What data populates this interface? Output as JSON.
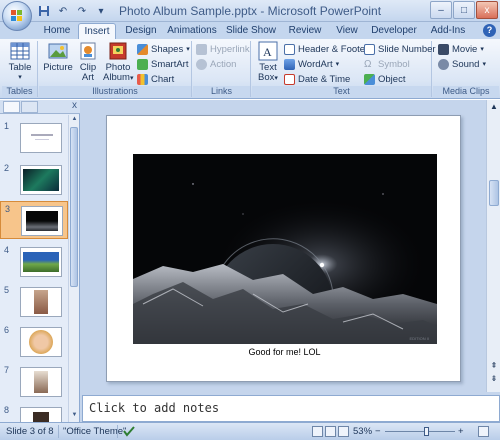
{
  "window": {
    "title": "Photo Album Sample.pptx - Microsoft PowerPoint",
    "minimize_glyph": "–",
    "maximize_glyph": "□",
    "close_glyph": "x"
  },
  "quick_access": {
    "undo_glyph": "↶",
    "redo_glyph": "↷",
    "customize_glyph": "▾"
  },
  "tabs": [
    "Home",
    "Insert",
    "Design",
    "Animations",
    "Slide Show",
    "Review",
    "View",
    "Developer",
    "Add-Ins"
  ],
  "active_tab": "Insert",
  "help_glyph": "?",
  "ribbon": {
    "tables": {
      "label": "Tables",
      "table_btn": "Table",
      "caret": "▾"
    },
    "illustrations": {
      "label": "Illustrations",
      "picture": "Picture",
      "clip_art_1": "Clip",
      "clip_art_2": "Art",
      "photo_album_1": "Photo",
      "photo_album_2": "Album",
      "caret": "▾",
      "shapes": "Shapes",
      "smartart": "SmartArt",
      "chart": "Chart"
    },
    "links": {
      "label": "Links",
      "hyperlink": "Hyperlink",
      "action": "Action"
    },
    "text": {
      "label": "Text",
      "text_box_1": "Text",
      "text_box_2": "Box",
      "caret": "▾",
      "header_footer": "Header & Footer",
      "wordart": "WordArt",
      "date_time": "Date & Time",
      "slide_number": "Slide Number",
      "symbol": "Symbol",
      "object": "Object"
    },
    "media": {
      "label": "Media Clips",
      "movie": "Movie",
      "sound": "Sound"
    }
  },
  "slides_panel": {
    "close_glyph": "x",
    "up_glyph": "▲",
    "down_glyph": "▼",
    "thumbnails": [
      {
        "num": "1",
        "kind": "title"
      },
      {
        "num": "2",
        "kind": "aurora"
      },
      {
        "num": "3",
        "kind": "space",
        "selected": true
      },
      {
        "num": "4",
        "kind": "landscape"
      },
      {
        "num": "5",
        "kind": "portrait"
      },
      {
        "num": "6",
        "kind": "face"
      },
      {
        "num": "7",
        "kind": "figure"
      },
      {
        "num": "8",
        "kind": "dark"
      }
    ]
  },
  "slide": {
    "caption": "Good for me! LOL",
    "photo_watermark": "EDITION II"
  },
  "right_scroll": {
    "up_glyph": "▲",
    "prev_glyph": "⇞",
    "next_glyph": "⇟"
  },
  "notes": {
    "placeholder": "Click to add notes"
  },
  "statusbar": {
    "slide_info": "Slide 3 of 8",
    "theme": "\"Office Theme\"",
    "zoom": "53%",
    "zoom_minus": "−",
    "zoom_plus": "+"
  }
}
